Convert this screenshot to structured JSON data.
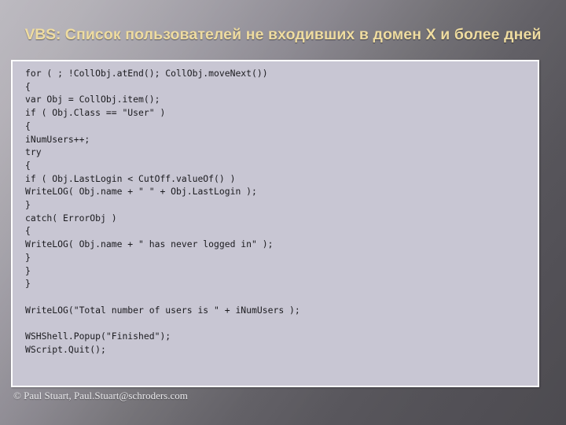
{
  "slide": {
    "title": {
      "prefix": "VBS:",
      "rest": " Список пользователей не входивших в домен X и более дней",
      "full": "VBS: Список пользователей не входивших в домен X и более дней",
      "color": "#efdca0"
    },
    "code_panel": {
      "background_color": "#c8c6d3",
      "border_color": "#ffffff",
      "text_color": "#1b1b1f",
      "lines": [
        "for ( ; !CollObj.atEnd(); CollObj.moveNext())",
        "{",
        "var Obj = CollObj.item();",
        "if ( Obj.Class == \"User\" )",
        "{",
        "iNumUsers++;",
        "try",
        "{",
        "if ( Obj.LastLogin < CutOff.valueOf() )",
        "WriteLOG( Obj.name + \" \" + Obj.LastLogin );",
        "}",
        "catch( ErrorObj )",
        "{",
        "WriteLOG( Obj.name + \" has never logged in\" );",
        "}",
        "}",
        "}",
        "",
        "WriteLOG(\"Total number of users is \" + iNumUsers );",
        "",
        "WSHShell.Popup(\"Finished\");",
        "WScript.Quit();"
      ],
      "code_text": "for ( ; !CollObj.atEnd(); CollObj.moveNext())\n{\nvar Obj = CollObj.item();\nif ( Obj.Class == \"User\" )\n{\niNumUsers++;\ntry\n{\nif ( Obj.LastLogin < CutOff.valueOf() )\nWriteLOG( Obj.name + \" \" + Obj.LastLogin );\n}\ncatch( ErrorObj )\n{\nWriteLOG( Obj.name + \" has never logged in\" );\n}\n}\n}\n\nWriteLOG(\"Total number of users is \" + iNumUsers );\n\nWSHShell.Popup(\"Finished\");\nWScript.Quit();"
    },
    "footer": {
      "text": "© Paul Stuart, Paul.Stuart@schroders.com",
      "color": "#e9e9ec"
    },
    "background": {
      "from_color": "#b5b2b9",
      "to_color": "#514f55"
    }
  }
}
